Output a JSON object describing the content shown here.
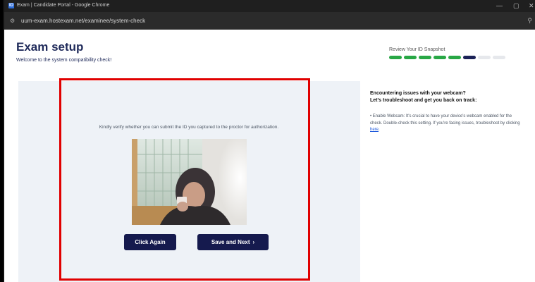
{
  "browser": {
    "tab_title": "Exam | Candidate Portal - Google Chrome",
    "favicon_label": "ID",
    "url": "uum-exam.hostexam.net/examinee/system-check",
    "minimize_glyph": "—",
    "restore_glyph": "▢",
    "close_glyph": "✕"
  },
  "header": {
    "title": "Exam setup",
    "subtitle": "Welcome to the system compatibility check!"
  },
  "progress": {
    "label": "Review Your ID Snapshot",
    "segments_total": 8,
    "segments_done": 5,
    "current_index": 5
  },
  "main": {
    "instruction": "Kindly verify whether you can submit the ID you captured to the proctor for authorization.",
    "click_again_label": "Click Again",
    "save_next_label": "Save and Next",
    "save_next_icon": "›"
  },
  "help": {
    "heading_line1": "Encountering issues with your webcam?",
    "heading_line2": "Let's troubleshoot and get you back on track:",
    "body": "• Enable Webcam: It's crucial to have your device's webcam enabled for the check. Double-check this setting. If you're facing issues, troubleshoot by clicking ",
    "link_text": "here",
    "body_end": "."
  },
  "colors": {
    "brand_navy": "#151a4e",
    "progress_done": "#28a745",
    "progress_current": "#1b2257",
    "highlight_red": "#e00000"
  }
}
